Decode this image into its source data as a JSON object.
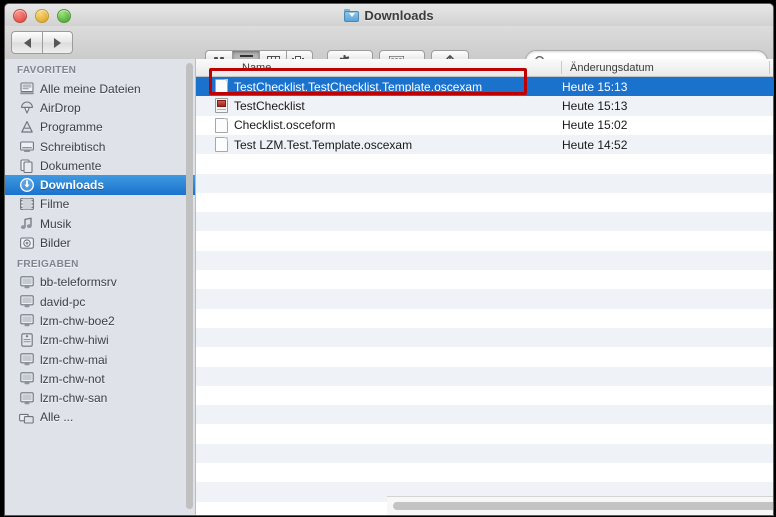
{
  "window": {
    "title": "Downloads",
    "title_icon": "downloads-folder-icon",
    "traffic_lights": {
      "close": "close-button",
      "minimize": "minimize-button",
      "zoom": "zoom-button",
      "close_color": "#e8605a",
      "minimize_color": "#e5b63e",
      "zoom_color": "#62bb47"
    }
  },
  "toolbar": {
    "back_label": "◀",
    "forward_label": "▶",
    "view_modes": [
      {
        "name": "icon-view",
        "selected": false
      },
      {
        "name": "list-view",
        "selected": true
      },
      {
        "name": "column-view",
        "selected": false
      },
      {
        "name": "coverflow-view",
        "selected": false
      }
    ],
    "action_menu": "gear-icon",
    "arrange_menu": "arrange-icon",
    "share_button": "share-icon",
    "search": {
      "value": "",
      "placeholder": ""
    }
  },
  "sidebar": {
    "sections": [
      {
        "title": "FAVORITEN",
        "items": [
          {
            "label": "Alle meine Dateien",
            "icon": "all-files-icon",
            "selected": false
          },
          {
            "label": "AirDrop",
            "icon": "airdrop-icon",
            "selected": false
          },
          {
            "label": "Programme",
            "icon": "applications-icon",
            "selected": false
          },
          {
            "label": "Schreibtisch",
            "icon": "desktop-icon",
            "selected": false
          },
          {
            "label": "Dokumente",
            "icon": "documents-icon",
            "selected": false
          },
          {
            "label": "Downloads",
            "icon": "downloads-icon",
            "selected": true
          },
          {
            "label": "Filme",
            "icon": "movies-icon",
            "selected": false
          },
          {
            "label": "Musik",
            "icon": "music-icon",
            "selected": false
          },
          {
            "label": "Bilder",
            "icon": "pictures-icon",
            "selected": false
          }
        ]
      },
      {
        "title": "FREIGABEN",
        "items": [
          {
            "label": "bb-teleformsrv",
            "icon": "network-computer-icon",
            "selected": false
          },
          {
            "label": "david-pc",
            "icon": "network-computer-icon",
            "selected": false
          },
          {
            "label": "lzm-chw-boe2",
            "icon": "network-computer-icon",
            "selected": false
          },
          {
            "label": "lzm-chw-hiwi",
            "icon": "network-mac-tower-icon",
            "selected": false
          },
          {
            "label": "lzm-chw-mai",
            "icon": "network-computer-icon",
            "selected": false
          },
          {
            "label": "lzm-chw-not",
            "icon": "network-computer-icon",
            "selected": false
          },
          {
            "label": "lzm-chw-san",
            "icon": "network-computer-icon",
            "selected": false
          },
          {
            "label": "Alle ...",
            "icon": "all-network-icon",
            "selected": false
          }
        ]
      }
    ]
  },
  "filelist": {
    "columns": [
      {
        "label": "Name"
      },
      {
        "label": "Änderungsdatum"
      },
      {
        "label": ""
      }
    ],
    "rows": [
      {
        "name": "TestChecklist.TestChecklist.Template.oscexam",
        "date": "Heute 15:13",
        "third": "",
        "icon": "document-icon",
        "selected": true
      },
      {
        "name": "TestChecklist",
        "date": "Heute 15:13",
        "third": "",
        "icon": "app-document-icon",
        "selected": false
      },
      {
        "name": "Checklist.osceform",
        "date": "Heute 15:02",
        "third": "",
        "icon": "document-icon",
        "selected": false
      },
      {
        "name": "Test LZM.Test.Template.oscexam",
        "date": "Heute 14:52",
        "third": "",
        "icon": "document-icon",
        "selected": false
      }
    ]
  },
  "annotation": {
    "color": "#c00000",
    "target": "TestChecklist.TestChecklist.Template.oscexam"
  }
}
